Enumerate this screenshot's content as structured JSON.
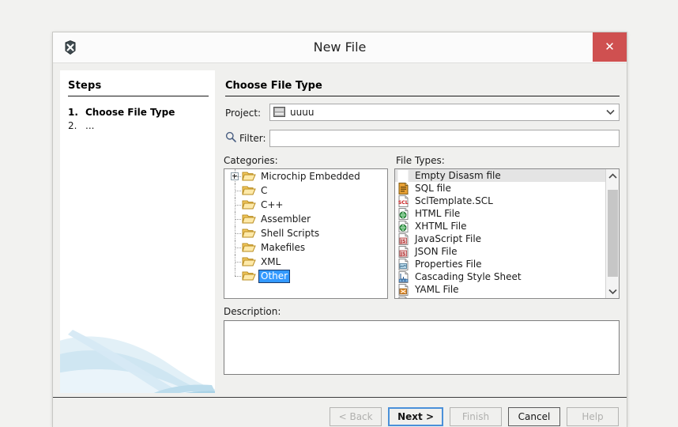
{
  "window": {
    "title": "New File",
    "app_icon": "app-x-icon",
    "close_label": "✕"
  },
  "steps": {
    "heading": "Steps",
    "items": [
      {
        "num": "1.",
        "label": "Choose File Type",
        "current": true
      },
      {
        "num": "2.",
        "label": "...",
        "current": false
      }
    ]
  },
  "content": {
    "heading": "Choose File Type",
    "project": {
      "label": "Project:",
      "value": "uuuu",
      "icon": "project-box-icon",
      "arrow": "chevron-down-icon"
    },
    "filter": {
      "label": "Filter:",
      "value": "",
      "placeholder": "",
      "icon": "search-icon"
    },
    "categories": {
      "label": "Categories:",
      "items": [
        {
          "label": "Microchip Embedded",
          "expandable": true,
          "selected": false
        },
        {
          "label": "C",
          "expandable": false,
          "selected": false
        },
        {
          "label": "C++",
          "expandable": false,
          "selected": false
        },
        {
          "label": "Assembler",
          "expandable": false,
          "selected": false
        },
        {
          "label": "Shell Scripts",
          "expandable": false,
          "selected": false
        },
        {
          "label": "Makefiles",
          "expandable": false,
          "selected": false
        },
        {
          "label": "XML",
          "expandable": false,
          "selected": false
        },
        {
          "label": "Other",
          "expandable": false,
          "selected": true
        }
      ]
    },
    "file_types": {
      "label": "File Types:",
      "items": [
        {
          "label": "Empty Disasm file",
          "icon": "blank-icon",
          "selected": true
        },
        {
          "label": "SQL file",
          "icon": "sql-icon",
          "selected": false
        },
        {
          "label": "SclTemplate.SCL",
          "icon": "scl-icon",
          "selected": false
        },
        {
          "label": "HTML File",
          "icon": "html-icon",
          "selected": false
        },
        {
          "label": "XHTML File",
          "icon": "xhtml-icon",
          "selected": false
        },
        {
          "label": "JavaScript File",
          "icon": "js-icon",
          "selected": false
        },
        {
          "label": "JSON File",
          "icon": "json-icon",
          "selected": false
        },
        {
          "label": "Properties File",
          "icon": "properties-icon",
          "selected": false
        },
        {
          "label": "Cascading Style Sheet",
          "icon": "css-icon",
          "selected": false
        },
        {
          "label": "YAML File",
          "icon": "yaml-icon",
          "selected": false
        },
        {
          "label": "",
          "icon": "partial-icon",
          "selected": false
        }
      ],
      "scrollbar": {
        "up_arrow": "chevron-up-icon",
        "down_arrow": "chevron-down-icon"
      }
    },
    "description": {
      "label": "Description:",
      "value": ""
    }
  },
  "footer": {
    "buttons": [
      {
        "label": "< Back",
        "state": "disabled"
      },
      {
        "label": "Next >",
        "state": "default"
      },
      {
        "label": "Finish",
        "state": "disabled"
      },
      {
        "label": "Cancel",
        "state": "enabled"
      },
      {
        "label": "Help",
        "state": "disabled"
      }
    ]
  },
  "colors": {
    "close_red": "#cf5050",
    "selection_blue": "#3399ff",
    "default_button_blue": "#4a90d9",
    "folder_gold": "#f0c14b"
  }
}
